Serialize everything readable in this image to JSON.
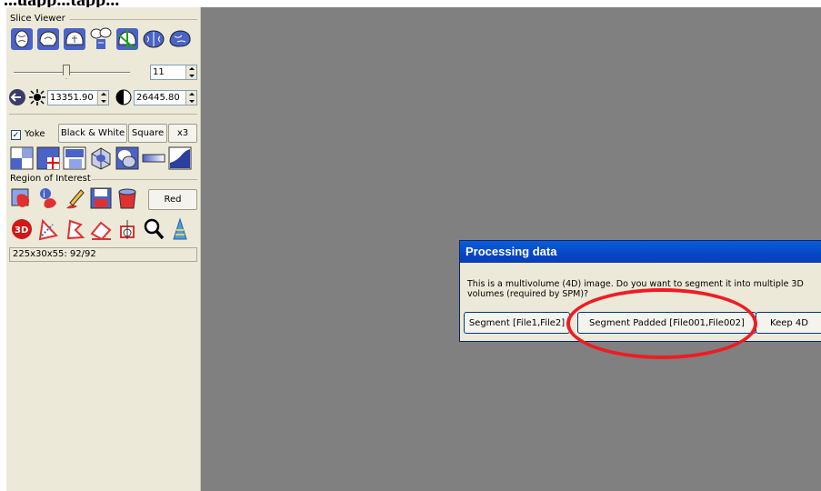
{
  "caption": "...uapp...tapp...",
  "panel": {
    "slice_viewer_label": "Slice Viewer",
    "slice_value": "11",
    "brightness_value": "13351.90",
    "contrast_value": "26445.80",
    "yoke_label": "Yoke",
    "yoke_checked": "✓",
    "bw_label": "Black & White",
    "square_label": "Square",
    "x3_label": "x3",
    "roi_label": "Region of Interest",
    "red_label": "Red",
    "status_text": "225x30x55: 92/92"
  },
  "dialog": {
    "title": "Processing data",
    "message": "This is a multivolume (4D) image. Do you want to segment it into multiple 3D volumes (required by SPM)?",
    "btn_segment": "Segment [File1,File2]",
    "btn_segment_padded": "Segment Padded [File001,File002]",
    "btn_keep": "Keep 4D"
  },
  "colors": {
    "viewer_bg": "#808080",
    "panel_bg": "#ece9d8",
    "title_bar": "#0546c7",
    "annotation": "#ee1c24"
  }
}
